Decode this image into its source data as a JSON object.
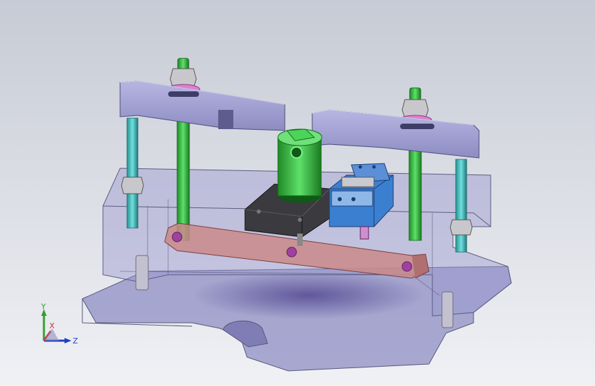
{
  "viewport": {
    "background_top": "#c9cdd6",
    "background_bottom": "#eef0f4"
  },
  "model": {
    "parts": [
      "base-plate",
      "frame-housing",
      "left-clamp-bar",
      "right-clamp-bar",
      "guide-rods",
      "threaded-studs",
      "hex-nuts",
      "pink-washers",
      "linkage-plate",
      "mount-block",
      "green-clamp-cylinder",
      "blue-actuator-block",
      "pivot-pins"
    ],
    "colors": {
      "base": "#8f8fc4",
      "bar": "#a9a8d8",
      "rod": "#2fbf3a",
      "cyan_rod": "#35b6b6",
      "link": "#c98a8a",
      "block": "#3a3a3f",
      "actuator": "#3b7fd1",
      "nut": "#c8c8cc",
      "washer": "#e07fd0",
      "pin": "#a041a0"
    }
  },
  "triad": {
    "x_label": "X",
    "y_label": "Y",
    "z_label": "Z",
    "x_color": "#d03030",
    "y_color": "#30a030",
    "z_color": "#2040c0"
  }
}
